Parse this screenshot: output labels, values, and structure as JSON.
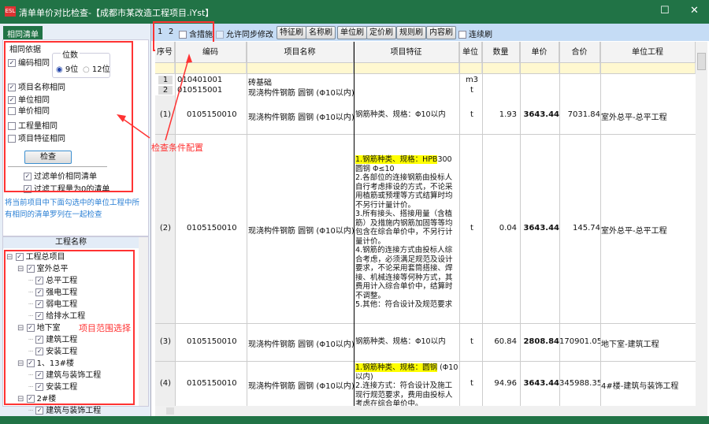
{
  "window": {
    "app_icon": "ESL",
    "title": "清单单价对比检查-【成都市某改造工程项目.iYst】",
    "maximize": "☐",
    "close": "✕"
  },
  "left": {
    "tab": "相同清单",
    "group_title": "相同依据",
    "digits_title": "位数",
    "digits_opts": [
      "9位",
      "12位"
    ],
    "digits_selected": "9位",
    "criteria": [
      {
        "label": "编码相同",
        "checked": true
      },
      {
        "label": "项目名称相同",
        "checked": true
      },
      {
        "label": "单位相同",
        "checked": true
      },
      {
        "label": "单价相同",
        "checked": false
      },
      {
        "label": "工程量相同",
        "checked": false
      },
      {
        "label": "项目特征相同",
        "checked": false
      }
    ],
    "check_button": "检查",
    "filters": [
      {
        "label": "过滤单价相同清单",
        "checked": true
      },
      {
        "label": "过滤工程量为0的清单",
        "checked": true
      }
    ],
    "note": "将当前项目中下面勾选中的单位工程中所有相同的清单罗列在一起检查",
    "tree_header": "工程名称",
    "tree": [
      {
        "label": "工程总项目",
        "level": 0
      },
      {
        "label": "室外总平",
        "level": 1
      },
      {
        "label": "总平工程",
        "level": 2
      },
      {
        "label": "强电工程",
        "level": 2
      },
      {
        "label": "弱电工程",
        "level": 2
      },
      {
        "label": "给排水工程",
        "level": 2
      },
      {
        "label": "地下室",
        "level": 1
      },
      {
        "label": "建筑工程",
        "level": 2
      },
      {
        "label": "安装工程",
        "level": 2
      },
      {
        "label": "1、13#楼",
        "level": 1
      },
      {
        "label": "建筑与装饰工程",
        "level": 2
      },
      {
        "label": "安装工程",
        "level": 2
      },
      {
        "label": "2#楼",
        "level": 1
      },
      {
        "label": "建筑与装饰工程",
        "level": 2
      }
    ]
  },
  "annotations": {
    "config": "检查条件配置",
    "scope": "项目范围选择"
  },
  "toolbar": {
    "levels": [
      "1",
      "2"
    ],
    "include_measures": "含措施",
    "allow_sync": "允许同步修改",
    "buttons": [
      "特征刷",
      "名称刷",
      "单位刷",
      "定价刷",
      "规则刷",
      "内容刷"
    ],
    "continuous": "连续刷"
  },
  "grid": {
    "headers": [
      "序号",
      "编码",
      "项目名称",
      "项目特征",
      "单位",
      "数量",
      "单价",
      "合价",
      "单位工程"
    ],
    "groups": [
      {
        "seq": "1",
        "code": "010401001",
        "name": "砖基础",
        "unit": "m3"
      },
      {
        "seq": "2",
        "code": "010515001",
        "name": "现浇构件钢筋 圆钢 (Φ10以内)",
        "unit": "t"
      }
    ],
    "rows": [
      {
        "seq": "(1)",
        "code": "0105150010",
        "name": "现浇构件钢筋 圆钢 (Φ10以内)",
        "feature_hl": "",
        "feature": "钢筋种类、规格：Φ10以内",
        "unit": "t",
        "qty": "1.93",
        "price": "3643.44",
        "total": "7031.84",
        "project": "室外总平-总平工程"
      },
      {
        "seq": "(2)",
        "code": "0105150010",
        "name": "现浇构件钢筋 圆钢 (Φ10以内)",
        "feature_hl": "1.钢筋种类、规格：HPB",
        "feature": "300圆钢 Φ≤10\n2.各部位的连接钢筋由投标人自行考虑摔设的方式，不论采用植筋或预埋等方式结算时均不另行计量计价。\n3.所有接头、搭接用量（含植筋）及措施内钢筋加固等等均包含在综合单价中，不另行计量计价。\n4.钢筋的连接方式由投标人综合考虑，必须满足规范及设计要求，不论采用套筒搭接、焊接、机械连接等何种方式，其费用计入综合单价中，结算时不调整。\n5.其他：符合设计及规范要求",
        "unit": "t",
        "qty": "0.04",
        "price": "3643.44",
        "total": "145.74",
        "project": "室外总平-总平工程"
      },
      {
        "seq": "(3)",
        "code": "0105150010",
        "name": "现浇构件钢筋 圆钢 (Φ10以内)",
        "feature_hl": "",
        "feature": "钢筋种类、规格：Φ10以内",
        "unit": "t",
        "qty": "60.84",
        "price": "2808.84",
        "total": "170901.05",
        "project": "地下室-建筑工程"
      },
      {
        "seq": "(4)",
        "code": "0105150010",
        "name": "现浇构件钢筋 圆钢 (Φ10以内)",
        "feature_hl": "1.钢筋种类、规格：圆钢",
        "feature": " (Φ10以内)\n2.连接方式：符合设计及施工现行规范要求，费用由投标人考虑在综合单价中。",
        "unit": "t",
        "qty": "94.96",
        "price": "3643.44",
        "total": "345988.35",
        "project": "4#楼-建筑与装饰工程"
      }
    ]
  },
  "colors": {
    "title_bar": "#217346",
    "toolbar": "#c5dcf5",
    "highlight": "#ffff00",
    "annotation": "#ff3333"
  }
}
